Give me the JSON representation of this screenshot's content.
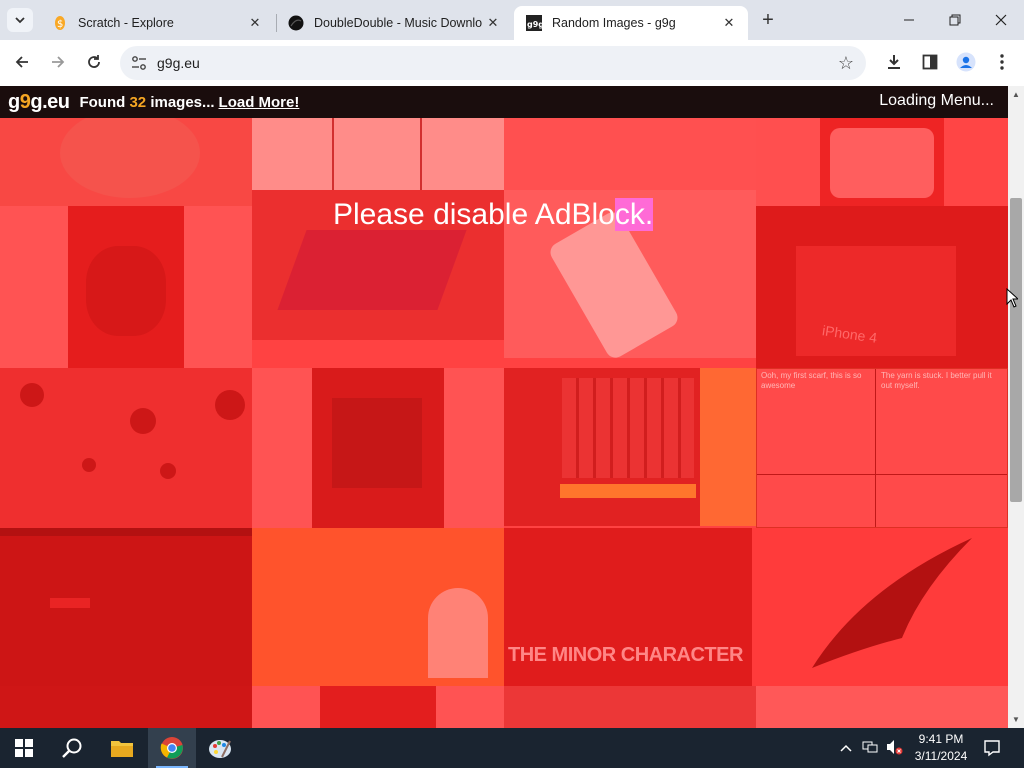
{
  "browser": {
    "tabs": [
      {
        "title": "Scratch - Explore",
        "favicon": "scratch-icon",
        "active": false
      },
      {
        "title": "DoubleDouble - Music Downlo",
        "favicon": "doubledouble-icon",
        "active": false
      },
      {
        "title": "Random Images - g9g",
        "favicon": "g9g-icon",
        "active": true
      }
    ],
    "url": "g9g.eu"
  },
  "site": {
    "logo": {
      "part1": "g",
      "part2": "9",
      "part3": "g",
      "part4": ".eu"
    },
    "found_prefix": "Found",
    "found_count": "32",
    "found_suffix": "images...",
    "load_more": "Load More!",
    "menu_status": "Loading Menu...",
    "banner": {
      "text_main": "Please disable AdBlo",
      "text_highlight": "ck."
    }
  },
  "tiles": {
    "phrase_minor_character": "THE MINOR CHARACTER",
    "phrase_iphone": "iPhone 4",
    "comic_text_1": "Ooh, my first scarf, this is so awesome",
    "comic_text_2": "The yarn is stuck. I better pull it out myself."
  },
  "taskbar": {
    "time": "9:41 PM",
    "date": "3/11/2024"
  },
  "colors": {
    "accent_orange": "#f5a623",
    "header_bg": "#1a0d0d",
    "page_red": "#ff5050",
    "highlight_pink": "#ff6ad6"
  }
}
